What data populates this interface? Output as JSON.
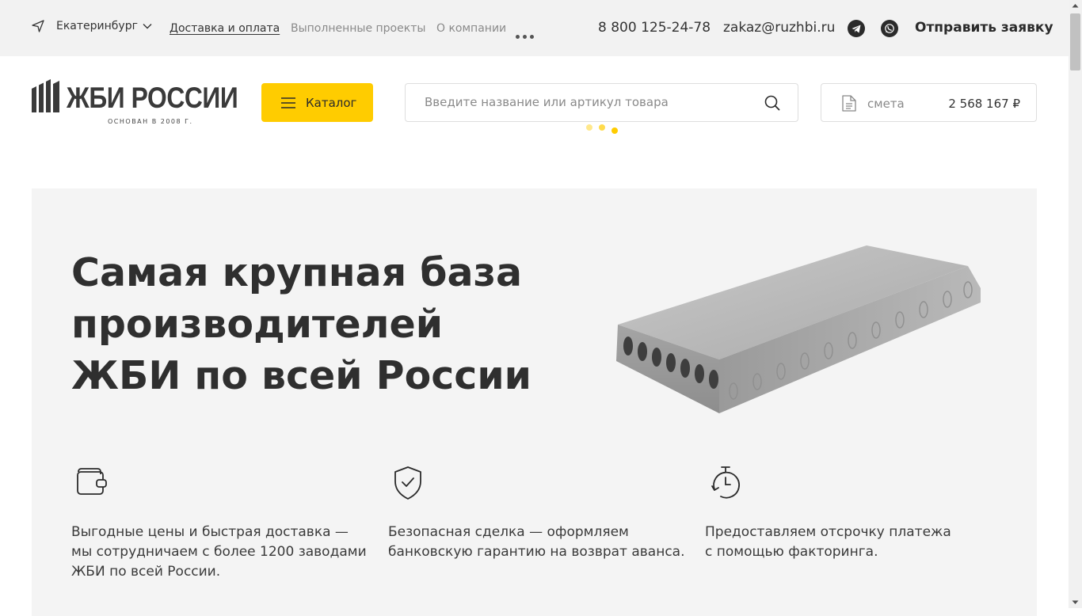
{
  "topbar": {
    "city": "Екатеринбург",
    "nav": [
      {
        "label": "Доставка и оплата",
        "active": true
      },
      {
        "label": "Выполненные проекты",
        "active": false
      },
      {
        "label": "О компании",
        "active": false
      }
    ],
    "more_icon": "ellipsis-icon",
    "phone": "8 800 125-24-78",
    "email": "zakaz@ruzhbi.ru",
    "social_icons": [
      "telegram-icon",
      "whatsapp-icon"
    ],
    "send_request_label": "Отправить заявку"
  },
  "header": {
    "logo_text": "ЖБИ РОССИИ",
    "logo_subtitle": "ОСНОВАН В 2008 Г.",
    "catalog_label": "Каталог",
    "search_placeholder": "Введите название или артикул товара",
    "estimate_label": "смета",
    "estimate_total": "2 568 167 ₽"
  },
  "hero": {
    "title_lines": [
      "Самая крупная база",
      "производителей",
      "ЖБИ по всей России"
    ],
    "features": [
      {
        "icon": "wallet-icon",
        "lines": [
          "Выгодные цены и быстрая доставка —",
          "мы сотрудничаем с более 1200 заводами",
          "ЖБИ по всей России."
        ]
      },
      {
        "icon": "shield-check-icon",
        "lines": [
          "Безопасная сделка — оформляем",
          "банковскую гарантию на возврат аванса."
        ]
      },
      {
        "icon": "timer-icon",
        "lines": [
          "Предоставляем отсрочку платежа",
          "с помощью факторинга."
        ]
      }
    ]
  },
  "colors": {
    "accent": "#ffcc00",
    "topbar_bg": "#f2f2f2",
    "hero_bg": "#f4f4f4",
    "text": "#2b2b2b"
  }
}
